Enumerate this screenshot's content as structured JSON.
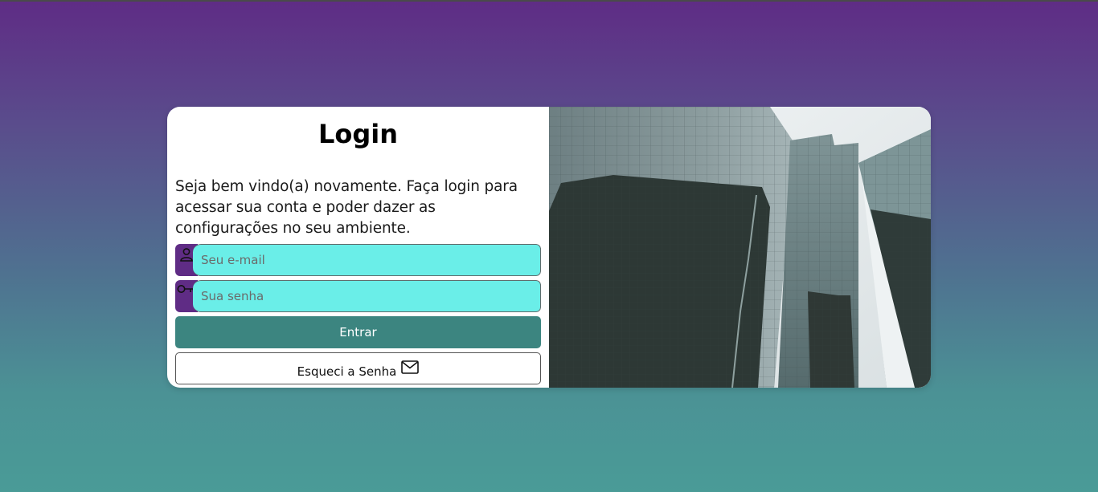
{
  "login": {
    "title": "Login",
    "intro": "Seja bem vindo(a) novamente. Faça login para acessar sua conta e poder dazer as configurações no seu ambiente.",
    "email_placeholder": "Seu e-mail",
    "password_placeholder": "Sua senha",
    "enter_label": "Entrar",
    "forgot_label": "Esqueci a Senha"
  },
  "icons": {
    "email_field": "user-icon",
    "password_field": "key-icon",
    "forgot_button": "mail-icon"
  },
  "colors": {
    "background_top": "#5f2c85",
    "background_bottom": "#4a9b97",
    "icon_box": "#5f2c85",
    "input_fill": "#6aeee8",
    "enter_button": "#3c8580"
  }
}
